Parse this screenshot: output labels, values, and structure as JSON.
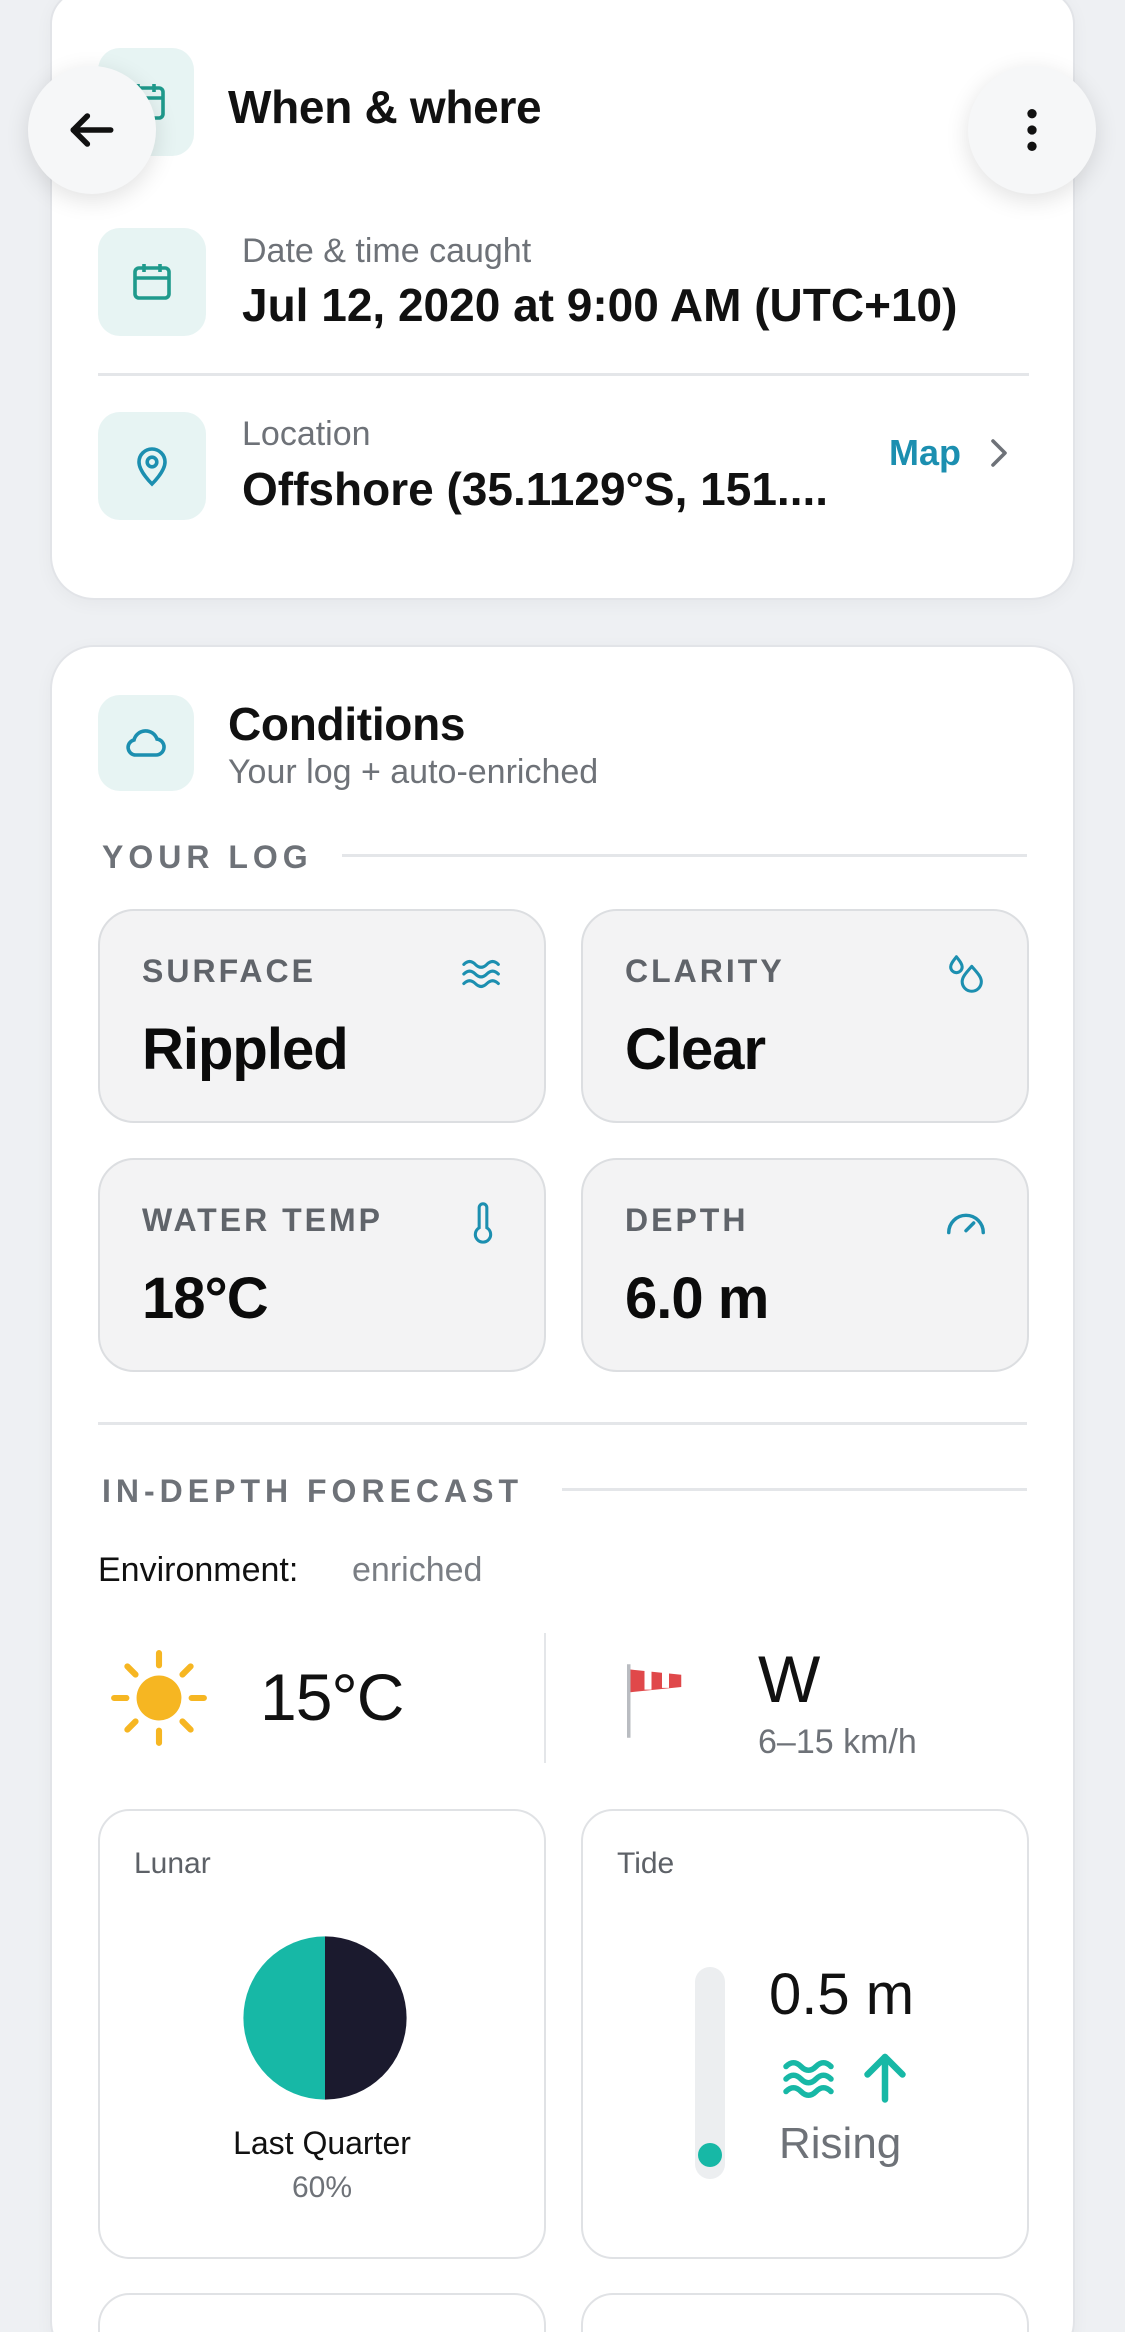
{
  "nav": {
    "back_icon": "arrow-left-icon",
    "more_icon": "more-vertical-icon"
  },
  "when_where": {
    "title": "When & where",
    "date_label": "Date & time caught",
    "date_value": "Jul 12, 2020 at 9:00 AM (UTC+10)",
    "location_label": "Location",
    "location_value": "Offshore (35.1129°S, 151....",
    "map_link": "Map"
  },
  "conditions": {
    "title": "Conditions",
    "subtitle": "Your log + auto-enriched",
    "your_log_label": "YOUR LOG",
    "tiles": [
      {
        "label": "SURFACE",
        "value": "Rippled",
        "icon": "waves-icon"
      },
      {
        "label": "CLARITY",
        "value": "Clear",
        "icon": "droplets-icon"
      },
      {
        "label": "WATER TEMP",
        "value": "18°C",
        "icon": "thermometer-icon"
      },
      {
        "label": "DEPTH",
        "value": "6.0 m",
        "icon": "gauge-icon"
      }
    ],
    "forecast_label": "IN-DEPTH FORECAST",
    "environment_label": "Environment:",
    "environment_value": "enriched",
    "air_temp": "15°C",
    "wind_dir": "W",
    "wind_speed": "6–15 km/h",
    "lunar": {
      "label": "Lunar",
      "phase": "Last Quarter",
      "illumination": "60%"
    },
    "tide": {
      "label": "Tide",
      "height": "0.5 m",
      "trend": "Rising",
      "level": 0.05
    }
  },
  "colors": {
    "accent": "#1c8fb0",
    "teal": "#17b8a6",
    "moon_dark": "#1b1a2e",
    "sun": "#f6b622"
  }
}
